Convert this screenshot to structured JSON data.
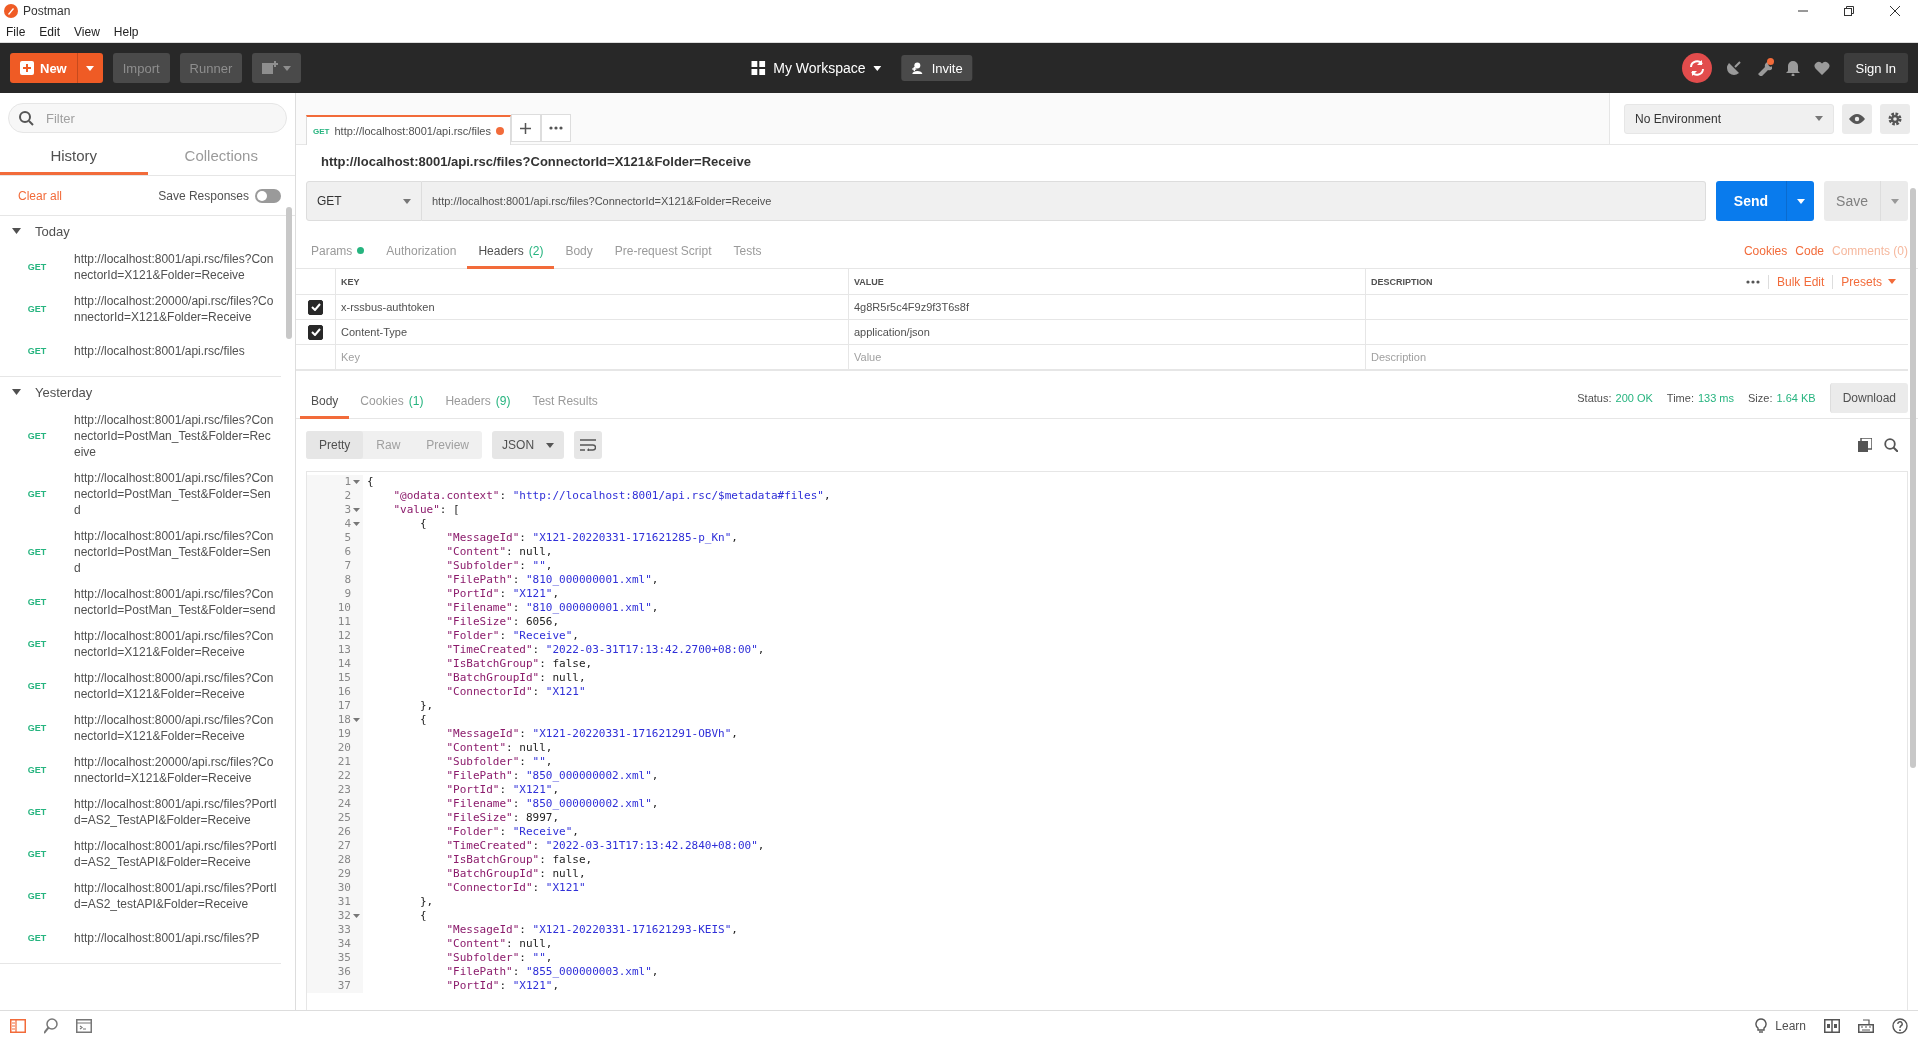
{
  "window": {
    "title": "Postman"
  },
  "menu": [
    "File",
    "Edit",
    "View",
    "Help"
  ],
  "header": {
    "new_button": "New",
    "import_button": "Import",
    "runner_button": "Runner",
    "workspace": "My Workspace",
    "invite_button": "Invite",
    "sign_in_button": "Sign In",
    "notification_badge": true
  },
  "sidebar": {
    "filter_placeholder": "Filter",
    "tabs": [
      {
        "label": "History",
        "selected": true
      },
      {
        "label": "Collections",
        "selected": false
      }
    ],
    "clear_all": "Clear all",
    "save_responses": {
      "label": "Save Responses",
      "on": false
    },
    "groups": [
      {
        "label": "Today",
        "expanded": true,
        "items": [
          {
            "method": "GET",
            "url": "http://localhost:8001/api.rsc/files?ConnectorId=X121&Folder=Receive"
          },
          {
            "method": "GET",
            "url": "http://localhost:20000/api.rsc/files?ConnectorId=X121&Folder=Receive"
          },
          {
            "method": "GET",
            "url": "http://localhost:8001/api.rsc/files"
          }
        ]
      },
      {
        "label": "Yesterday",
        "expanded": true,
        "items": [
          {
            "method": "GET",
            "url": "http://localhost:8001/api.rsc/files?ConnectorId=PostMan_Test&Folder=Receive"
          },
          {
            "method": "GET",
            "url": "http://localhost:8001/api.rsc/files?ConnectorId=PostMan_Test&Folder=Send"
          },
          {
            "method": "GET",
            "url": "http://localhost:8001/api.rsc/files?ConnectorId=PostMan_Test&Folder=Send"
          },
          {
            "method": "GET",
            "url": "http://localhost:8001/api.rsc/files?ConnectorId=PostMan_Test&Folder=send"
          },
          {
            "method": "GET",
            "url": "http://localhost:8001/api.rsc/files?ConnectorId=X121&Folder=Receive"
          },
          {
            "method": "GET",
            "url": "http://localhost:8000/api.rsc/files?ConnectorId=X121&Folder=Receive"
          },
          {
            "method": "GET",
            "url": "http://localhost:8000/api.rsc/files?ConnectorId=X121&Folder=Receive"
          },
          {
            "method": "GET",
            "url": "http://localhost:20000/api.rsc/files?ConnectorId=X121&Folder=Receive"
          },
          {
            "method": "GET",
            "url": "http://localhost:8001/api.rsc/files?PortId=AS2_TestAPI&Folder=Receive"
          },
          {
            "method": "GET",
            "url": "http://localhost:8001/api.rsc/files?PortId=AS2_TestAPI&Folder=Receive"
          },
          {
            "method": "GET",
            "url": "http://localhost:8001/api.rsc/files?PortId=AS2_testAPI&Folder=Receive"
          },
          {
            "method": "GET",
            "url": "http://localhost:8001/api.rsc/files?P"
          }
        ]
      }
    ]
  },
  "request_tabs": [
    {
      "method": "GET",
      "title": "http://localhost:8001/api.rsc/files",
      "unsaved": true,
      "selected": true
    }
  ],
  "environment": "No Environment",
  "request": {
    "title": "http://localhost:8001/api.rsc/files?ConnectorId=X121&Folder=Receive",
    "method": "GET",
    "url": "http://localhost:8001/api.rsc/files?ConnectorId=X121&Folder=Receive",
    "send_button": "Send",
    "save_button": "Save",
    "tabs": [
      {
        "label": "Params",
        "indicator": true,
        "selected": false
      },
      {
        "label": "Authorization",
        "selected": false
      },
      {
        "label": "Headers",
        "count": "(2)",
        "selected": true
      },
      {
        "label": "Body",
        "selected": false
      },
      {
        "label": "Pre-request Script",
        "selected": false
      },
      {
        "label": "Tests",
        "selected": false
      }
    ],
    "links": [
      {
        "label": "Cookies",
        "disabled": false
      },
      {
        "label": "Code",
        "disabled": false
      },
      {
        "label": "Comments (0)",
        "disabled": true
      }
    ],
    "headers_table": {
      "columns": [
        "KEY",
        "VALUE",
        "DESCRIPTION"
      ],
      "bulk_edit": "Bulk Edit",
      "presets": "Presets",
      "rows": [
        {
          "checked": true,
          "key": "x-rssbus-authtoken",
          "value": "4g8R5r5c4F9z9f3T6s8f"
        },
        {
          "checked": true,
          "key": "Content-Type",
          "value": "application/json"
        }
      ],
      "new_row": [
        {
          "placeholder": "Key"
        },
        {
          "placeholder": "Value"
        },
        {
          "placeholder": "Description"
        }
      ]
    }
  },
  "response": {
    "tabs": [
      {
        "label": "Body",
        "selected": true
      },
      {
        "label": "Cookies",
        "count": "(1)",
        "selected": false
      },
      {
        "label": "Headers",
        "count": "(9)",
        "selected": false
      },
      {
        "label": "Test Results",
        "selected": false
      }
    ],
    "status": [
      {
        "label": "Status:",
        "value": "200 OK"
      },
      {
        "label": "Time:",
        "value": "133 ms"
      },
      {
        "label": "Size:",
        "value": "1.64 KB"
      }
    ],
    "download_button": "Download",
    "view_modes": [
      {
        "label": "Pretty",
        "selected": true
      },
      {
        "label": "Raw",
        "selected": false
      },
      {
        "label": "Preview",
        "selected": false
      }
    ],
    "format": "JSON",
    "lines": [
      {
        "number": "1",
        "fold": true,
        "code": "{"
      },
      {
        "number": "2",
        "fold": false,
        "code": "    \"@odata.context\": \"http://localhost:8001/api.rsc/$metadata#files\","
      },
      {
        "number": "3",
        "fold": true,
        "code": "    \"value\": ["
      },
      {
        "number": "4",
        "fold": true,
        "code": "        {"
      },
      {
        "number": "5",
        "fold": false,
        "code": "            \"MessageId\": \"X121-20220331-171621285-p_Kn\","
      },
      {
        "number": "6",
        "fold": false,
        "code": "            \"Content\": null,"
      },
      {
        "number": "7",
        "fold": false,
        "code": "            \"Subfolder\": \"\","
      },
      {
        "number": "8",
        "fold": false,
        "code": "            \"FilePath\": \"810_000000001.xml\","
      },
      {
        "number": "9",
        "fold": false,
        "code": "            \"PortId\": \"X121\","
      },
      {
        "number": "10",
        "fold": false,
        "code": "            \"Filename\": \"810_000000001.xml\","
      },
      {
        "number": "11",
        "fold": false,
        "code": "            \"FileSize\": 6056,"
      },
      {
        "number": "12",
        "fold": false,
        "code": "            \"Folder\": \"Receive\","
      },
      {
        "number": "13",
        "fold": false,
        "code": "            \"TimeCreated\": \"2022-03-31T17:13:42.2700+08:00\","
      },
      {
        "number": "14",
        "fold": false,
        "code": "            \"IsBatchGroup\": false,"
      },
      {
        "number": "15",
        "fold": false,
        "code": "            \"BatchGroupId\": null,"
      },
      {
        "number": "16",
        "fold": false,
        "code": "            \"ConnectorId\": \"X121\""
      },
      {
        "number": "17",
        "fold": false,
        "code": "        },"
      },
      {
        "number": "18",
        "fold": true,
        "code": "        {"
      },
      {
        "number": "19",
        "fold": false,
        "code": "            \"MessageId\": \"X121-20220331-171621291-OBVh\","
      },
      {
        "number": "20",
        "fold": false,
        "code": "            \"Content\": null,"
      },
      {
        "number": "21",
        "fold": false,
        "code": "            \"Subfolder\": \"\","
      },
      {
        "number": "22",
        "fold": false,
        "code": "            \"FilePath\": \"850_000000002.xml\","
      },
      {
        "number": "23",
        "fold": false,
        "code": "            \"PortId\": \"X121\","
      },
      {
        "number": "24",
        "fold": false,
        "code": "            \"Filename\": \"850_000000002.xml\","
      },
      {
        "number": "25",
        "fold": false,
        "code": "            \"FileSize\": 8997,"
      },
      {
        "number": "26",
        "fold": false,
        "code": "            \"Folder\": \"Receive\","
      },
      {
        "number": "27",
        "fold": false,
        "code": "            \"TimeCreated\": \"2022-03-31T17:13:42.2840+08:00\","
      },
      {
        "number": "28",
        "fold": false,
        "code": "            \"IsBatchGroup\": false,"
      },
      {
        "number": "29",
        "fold": false,
        "code": "            \"BatchGroupId\": null,"
      },
      {
        "number": "30",
        "fold": false,
        "code": "            \"ConnectorId\": \"X121\""
      },
      {
        "number": "31",
        "fold": false,
        "code": "        },"
      },
      {
        "number": "32",
        "fold": true,
        "code": "        {"
      },
      {
        "number": "33",
        "fold": false,
        "code": "            \"MessageId\": \"X121-20220331-171621293-KEIS\","
      },
      {
        "number": "34",
        "fold": false,
        "code": "            \"Content\": null,"
      },
      {
        "number": "35",
        "fold": false,
        "code": "            \"Subfolder\": \"\","
      },
      {
        "number": "36",
        "fold": false,
        "code": "            \"FilePath\": \"855_000000003.xml\","
      },
      {
        "number": "37",
        "fold": false,
        "code": "            \"PortId\": \"X121\","
      }
    ]
  },
  "status_bar": {
    "learn": "Learn"
  }
}
